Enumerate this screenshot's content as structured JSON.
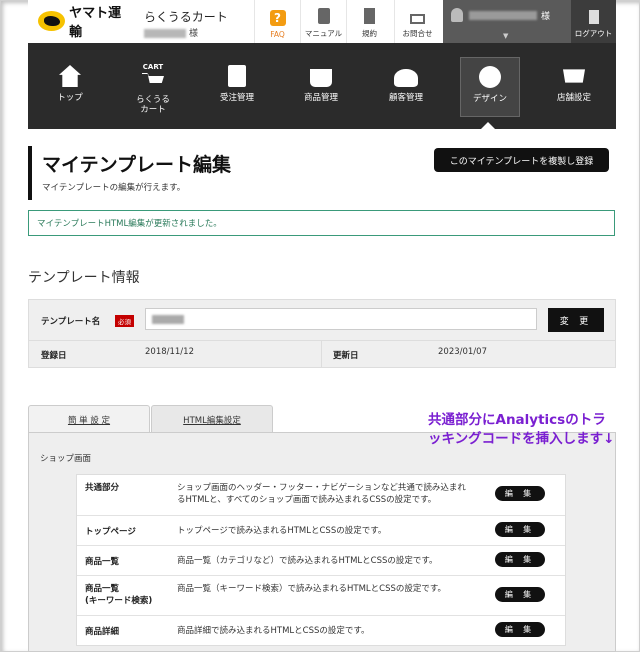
{
  "header": {
    "logo_text": "ヤマト運輸",
    "app_title": "らくうるカート",
    "user_suffix": "様",
    "faq": "FAQ",
    "manual": "マニュアル",
    "terms": "規約",
    "contact": "お問合せ",
    "account_suffix": "様",
    "logout": "ログアウト",
    "caret": "▼"
  },
  "nav": {
    "items": [
      {
        "label": "トップ"
      },
      {
        "label": "らくうる\nカート"
      },
      {
        "label": "受注管理"
      },
      {
        "label": "商品管理"
      },
      {
        "label": "顧客管理"
      },
      {
        "label": "デザイン"
      },
      {
        "label": "店舗設定"
      }
    ],
    "cart_badge": "CART"
  },
  "page": {
    "title": "マイテンプレート編集",
    "subtitle": "マイテンプレートの編集が行えます。",
    "copy_button": "このマイテンプレートを複製し登録",
    "notice": "マイテンプレートHTML編集が更新されました。",
    "section_title": "テンプレート情報"
  },
  "template_info": {
    "name_label": "テンプレート名",
    "required": "必須",
    "change_button": "変 更",
    "registered_label": "登録日",
    "registered_value": "2018/11/12",
    "updated_label": "更新日",
    "updated_value": "2023/01/07"
  },
  "tabs": [
    {
      "label": "簡 単 設 定"
    },
    {
      "label": "HTML編集設定"
    }
  ],
  "annotation": "共通部分にAnalyticsのトラッキングコードを挿入します↓",
  "shop_screen": {
    "label": "ショップ画面",
    "edit_label": "編 集",
    "rows": [
      {
        "name": "共通部分",
        "desc": "ショップ画面のヘッダー・フッター・ナビゲーションなど共通で読み込まれるHTMLと、すべてのショップ画面で読み込まれるCSSの設定です。"
      },
      {
        "name": "トップページ",
        "desc": "トップページで読み込まれるHTMLとCSSの設定です。"
      },
      {
        "name": "商品一覧",
        "desc": "商品一覧（カテゴリなど）で読み込まれるHTMLとCSSの設定です。"
      },
      {
        "name": "商品一覧\n(キーワード検索)",
        "desc": "商品一覧（キーワード検索）で読み込まれるHTMLとCSSの設定です。"
      },
      {
        "name": "商品詳細",
        "desc": "商品詳細で読み込まれるHTMLとCSSの設定です。"
      }
    ]
  },
  "colors": {
    "nav_bg": "#2b2b2b",
    "accent_purple": "#7a1fd1",
    "notice_green": "#3a9a7a",
    "required_red": "#c40000"
  }
}
